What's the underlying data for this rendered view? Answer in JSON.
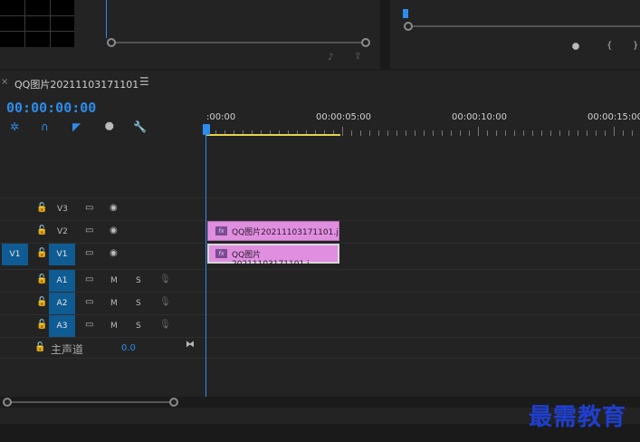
{
  "sequence": {
    "title": "QQ图片20211103171101",
    "timecode": "00:00:00:00"
  },
  "ruler": {
    "labels": [
      ":00:00",
      "00:00:05:00",
      "00:00:10:00",
      "00:00:15:00"
    ]
  },
  "tracks": {
    "video": [
      {
        "name": "V3",
        "source": ""
      },
      {
        "name": "V2",
        "source": ""
      },
      {
        "name": "V1",
        "source": "V1"
      }
    ],
    "audio": [
      {
        "name": "A1",
        "m": "M",
        "s": "S"
      },
      {
        "name": "A2",
        "m": "M",
        "s": "S"
      },
      {
        "name": "A3",
        "m": "M",
        "s": "S"
      }
    ],
    "master": {
      "name": "主声道",
      "value": "0.0"
    }
  },
  "clips": [
    {
      "track": "V2",
      "label": "QQ图片20211103171101.j",
      "fx": "fx"
    },
    {
      "track": "V1",
      "label": "QQ图片20211103171101.j",
      "fx": "fx"
    }
  ],
  "colors": {
    "accent": "#2d8ceb",
    "clip": "#e08ee0",
    "target": "#0f5b93",
    "work_area": "#e5d24a"
  },
  "watermark": "最需教育",
  "icons": {
    "close": "close-icon",
    "menu": "hamburger-menu-icon",
    "snap": "snap-icon",
    "linked": "magnet-icon",
    "marker": "marker-icon",
    "settings": "wrench-icon",
    "lock": "lock-icon",
    "eye": "eye-icon",
    "film": "film-icon",
    "mic": "mic-icon"
  }
}
